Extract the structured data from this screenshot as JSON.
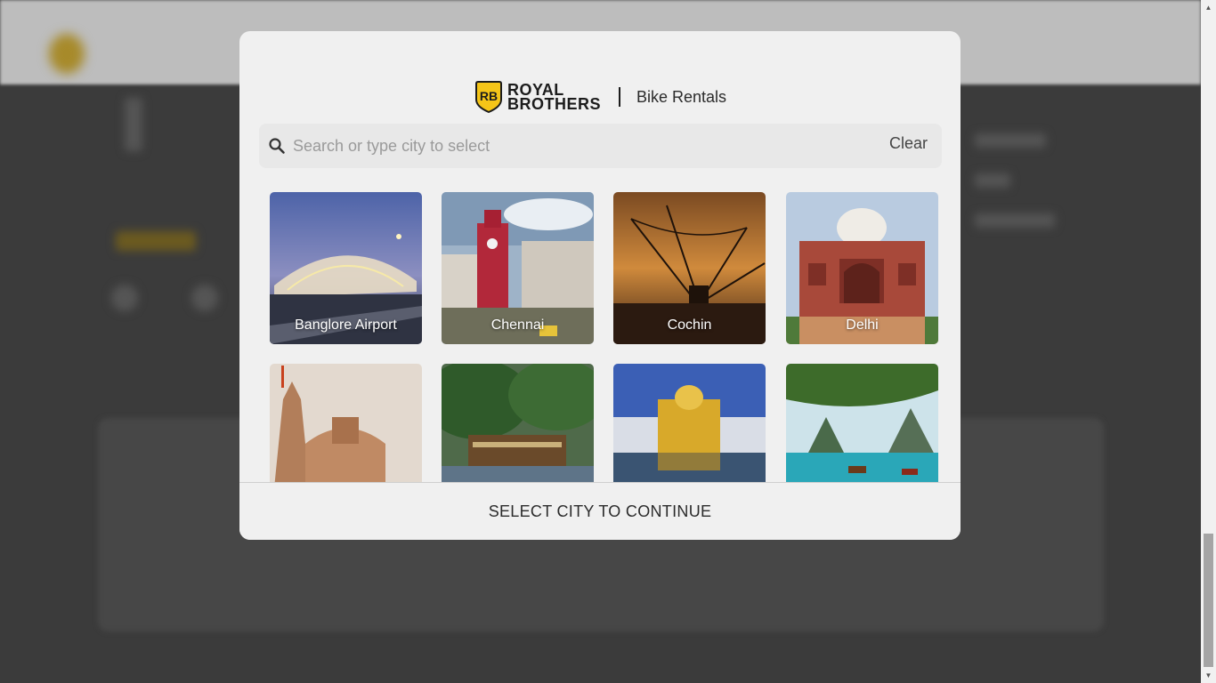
{
  "brand": {
    "name_line1": "ROYAL",
    "name_line2": "BROTHERS",
    "badge": "RB",
    "subtitle": "Bike Rentals"
  },
  "search": {
    "placeholder": "Search or type city to select",
    "value": "",
    "clear_label": "Clear",
    "icon": "search-icon"
  },
  "cities": [
    {
      "label": "Banglore Airport"
    },
    {
      "label": "Chennai"
    },
    {
      "label": "Cochin"
    },
    {
      "label": "Delhi"
    },
    {
      "label": ""
    },
    {
      "label": ""
    },
    {
      "label": ""
    },
    {
      "label": ""
    }
  ],
  "footer": {
    "continue_label": "SELECT CITY TO CONTINUE"
  },
  "colors": {
    "brand_yellow": "#f5c518",
    "modal_bg": "#f0f0f0",
    "overlay": "#3a3a3a"
  }
}
